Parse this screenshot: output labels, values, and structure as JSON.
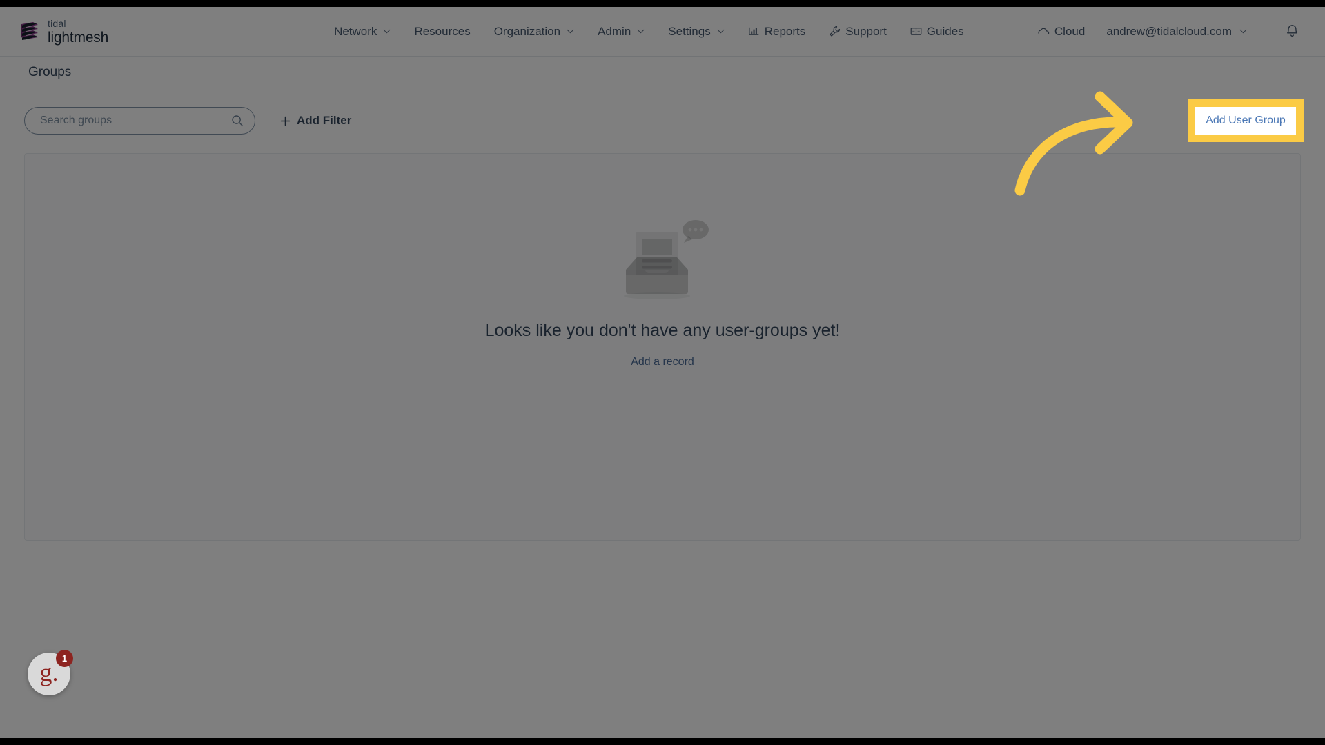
{
  "brand": {
    "top": "tidal",
    "bottom": "lightmesh",
    "mark_colors": {
      "primary": "#8e3d8e",
      "dark": "#1d2b3a"
    }
  },
  "nav": {
    "items": [
      {
        "label": "Network",
        "icon": "chevron-down-icon",
        "has_chevron": true
      },
      {
        "label": "Resources",
        "icon": "",
        "has_chevron": false
      },
      {
        "label": "Organization",
        "icon": "chevron-down-icon",
        "has_chevron": true
      },
      {
        "label": "Admin",
        "icon": "chevron-down-icon",
        "has_chevron": true
      },
      {
        "label": "Settings",
        "icon": "chevron-down-icon",
        "has_chevron": true
      },
      {
        "label": "Reports",
        "icon": "bar-chart-icon",
        "has_chevron": false
      },
      {
        "label": "Support",
        "icon": "wrench-icon",
        "has_chevron": false
      },
      {
        "label": "Guides",
        "icon": "book-icon",
        "has_chevron": false
      },
      {
        "label": "Cloud",
        "icon": "cloud-icon",
        "has_chevron": false
      }
    ],
    "user_email": "andrew@tidalcloud.com",
    "notification_icon": "bell-icon"
  },
  "header": {
    "page_title": "Groups"
  },
  "toolbar": {
    "search_placeholder": "Search groups",
    "search_value": "",
    "search_icon": "search-icon",
    "add_filter_label": "Add Filter",
    "add_filter_icon": "plus-icon",
    "primary_button_label": "Add User Group"
  },
  "empty_state": {
    "illustration": "empty-inbox-icon",
    "title": "Looks like you don't have any user-groups yet!",
    "link_label": "Add a record"
  },
  "annotation": {
    "highlight_color": "#FBCB45",
    "highlighted_label": "Add User Group",
    "arrow_icon": "curved-arrow-right-icon"
  },
  "widget": {
    "logo_text": "g.",
    "badge_count": "1",
    "brand_color": "#8d2420"
  }
}
